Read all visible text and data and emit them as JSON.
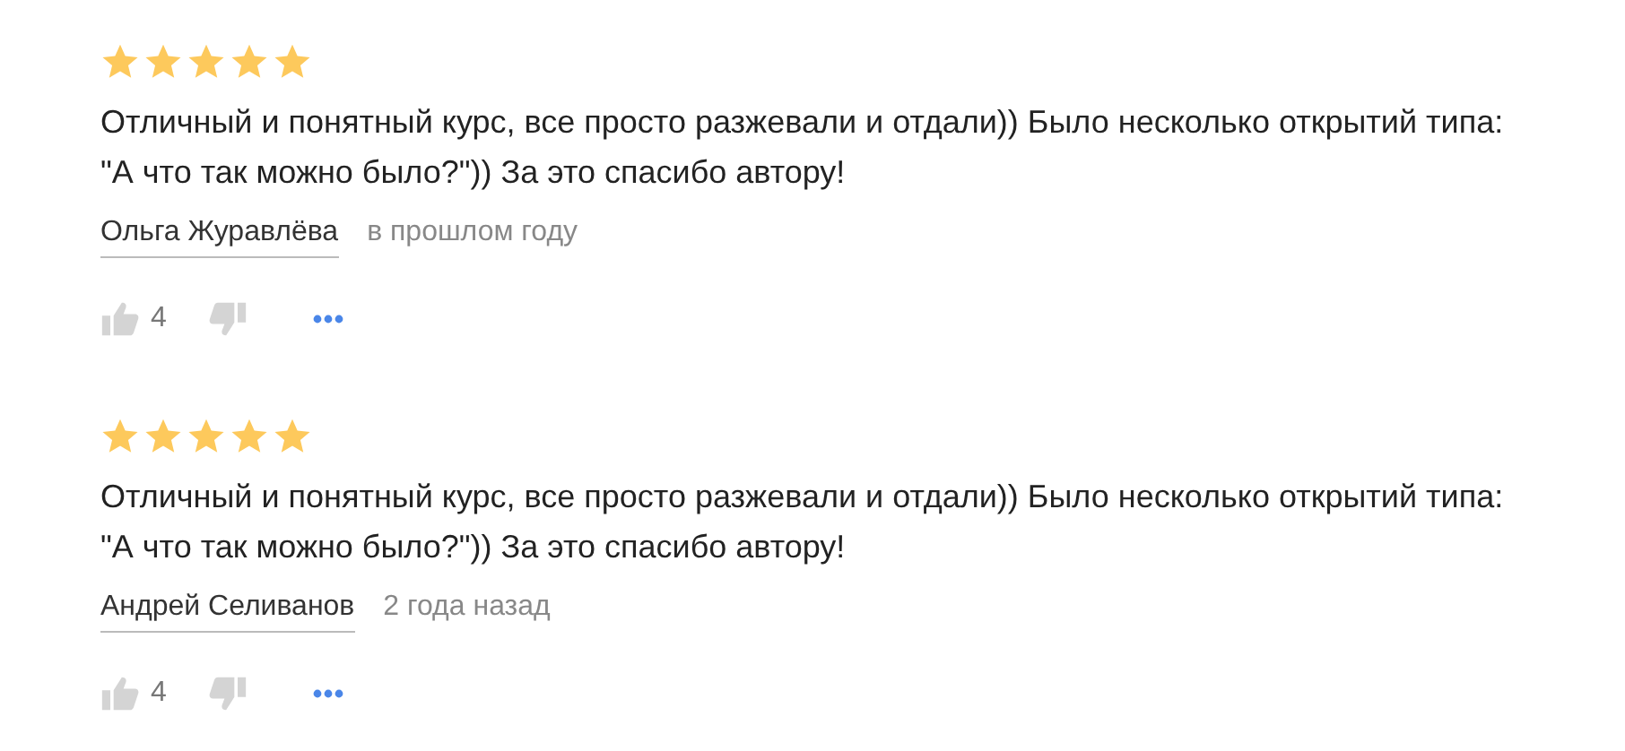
{
  "reviews": [
    {
      "stars": 5,
      "text": "Отличный и понятный курс, все просто разжевали и отдали)) Было несколько открытий типа: \"А что так можно было?\")) За это спасибо автору!",
      "author": "Ольга Журавлёва",
      "date": "в прошлом году",
      "likes": "4"
    },
    {
      "stars": 5,
      "text": "Отличный и понятный курс, все просто разжевали и отдали)) Было несколько открытий типа: \"А что так можно было?\")) За это спасибо автору!",
      "author": "Андрей Селиванов",
      "date": "2 года назад",
      "likes": "4"
    }
  ]
}
